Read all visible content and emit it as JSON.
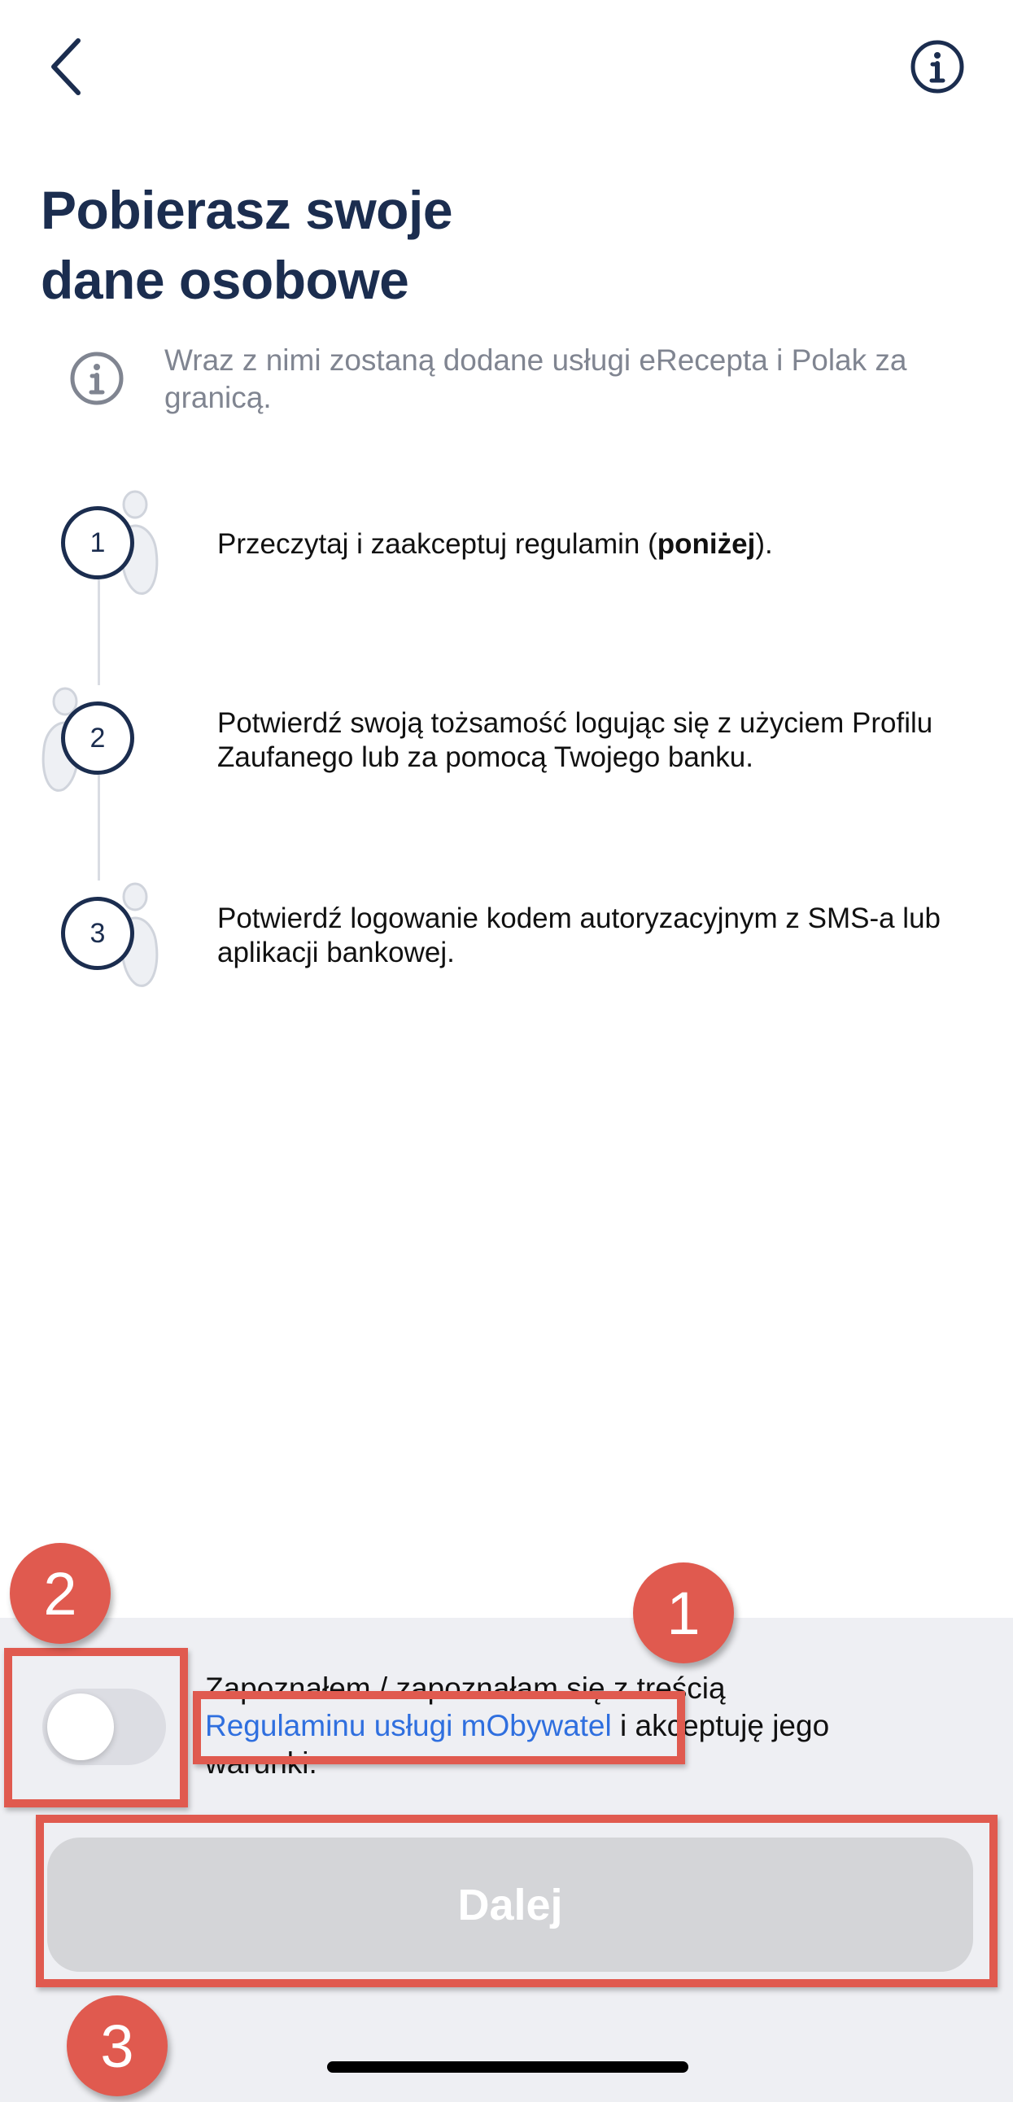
{
  "nav": {
    "back_icon": "chevron-left-icon",
    "info_icon": "info-circle-icon"
  },
  "title": {
    "line1": "Pobierasz swoje",
    "line2": "dane osobowe"
  },
  "info_note": {
    "icon": "info-circle-icon",
    "text": "Wraz z nimi zostaną dodane usługi eRecepta i Polak za granicą."
  },
  "steps": [
    {
      "number": "1",
      "text_before": "Przeczytaj i zaakceptuj regulamin (",
      "text_bold": "poniżej",
      "text_after": ")."
    },
    {
      "number": "2",
      "text": "Potwierdź swoją tożsamość logując się z użyciem Profilu Zaufanego lub za pomocą Twojego banku."
    },
    {
      "number": "3",
      "text": "Potwierdź logowanie kodem autoryzacyjnym z SMS-a lub aplikacji bankowej."
    }
  ],
  "consent": {
    "toggle_on": false,
    "line1": "Zapoznałem / zapoznałam się z treścią",
    "link_text": "Regulaminu usługi mObywatel",
    "line2_after": " i akceptuję jego",
    "line3": "warunki."
  },
  "next_button": {
    "label": "Dalej",
    "enabled": false
  },
  "annotations": [
    {
      "label": "1",
      "target": "terms-link"
    },
    {
      "label": "2",
      "target": "consent-toggle"
    },
    {
      "label": "3",
      "target": "next-button"
    }
  ],
  "colors": {
    "navy": "#1b2d4f",
    "link_blue": "#2f6fdf",
    "annotation_red": "#e05a4f",
    "disabled_button": "#d4d5d8",
    "panel_bg": "#eeeff3"
  }
}
